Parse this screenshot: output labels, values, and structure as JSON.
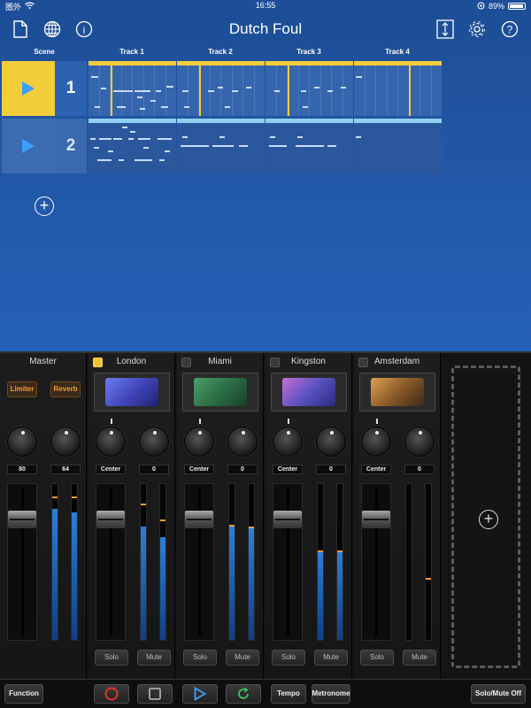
{
  "status": {
    "carrier": "圏外",
    "time": "16:55",
    "battery": "89%"
  },
  "navbar": {
    "title": "Dutch Foul",
    "icons": [
      "document-icon",
      "globe-icon",
      "info-icon",
      "export-icon",
      "gear-icon",
      "help-icon"
    ]
  },
  "grid": {
    "scene_header": "Scene",
    "tracks": [
      "Track 1",
      "Track 2",
      "Track 3",
      "Track 4"
    ],
    "scenes": [
      {
        "number": "1",
        "active": true
      },
      {
        "number": "2",
        "active": false
      }
    ]
  },
  "mixer": {
    "master": {
      "name": "Master",
      "limiter_label": "Limiter",
      "reverb_label": "Reverb",
      "value1": "80",
      "value2": "64"
    },
    "channels": [
      {
        "name": "London",
        "pan": "Center",
        "send": "0",
        "enabled": true,
        "solo_label": "Solo",
        "mute_label": "Mute"
      },
      {
        "name": "Miami",
        "pan": "Center",
        "send": "0",
        "enabled": false,
        "solo_label": "Solo",
        "mute_label": "Mute"
      },
      {
        "name": "Kingston",
        "pan": "Center",
        "send": "0",
        "enabled": false,
        "solo_label": "Solo",
        "mute_label": "Mute"
      },
      {
        "name": "Amsterdam",
        "pan": "Center",
        "send": "0",
        "enabled": false,
        "solo_label": "Solo",
        "mute_label": "Mute"
      }
    ]
  },
  "transport": {
    "function_label": "Function",
    "tempo_label": "Tempo",
    "metronome_label": "Metronome",
    "solomute_label": "Solo/Mute Off"
  },
  "colors": {
    "accent_yellow": "#f3cc3a",
    "bg_blue": "#1d4f99",
    "record_red": "#e53030",
    "play_blue": "#3aa0ff",
    "loop_green": "#3cc06a"
  }
}
